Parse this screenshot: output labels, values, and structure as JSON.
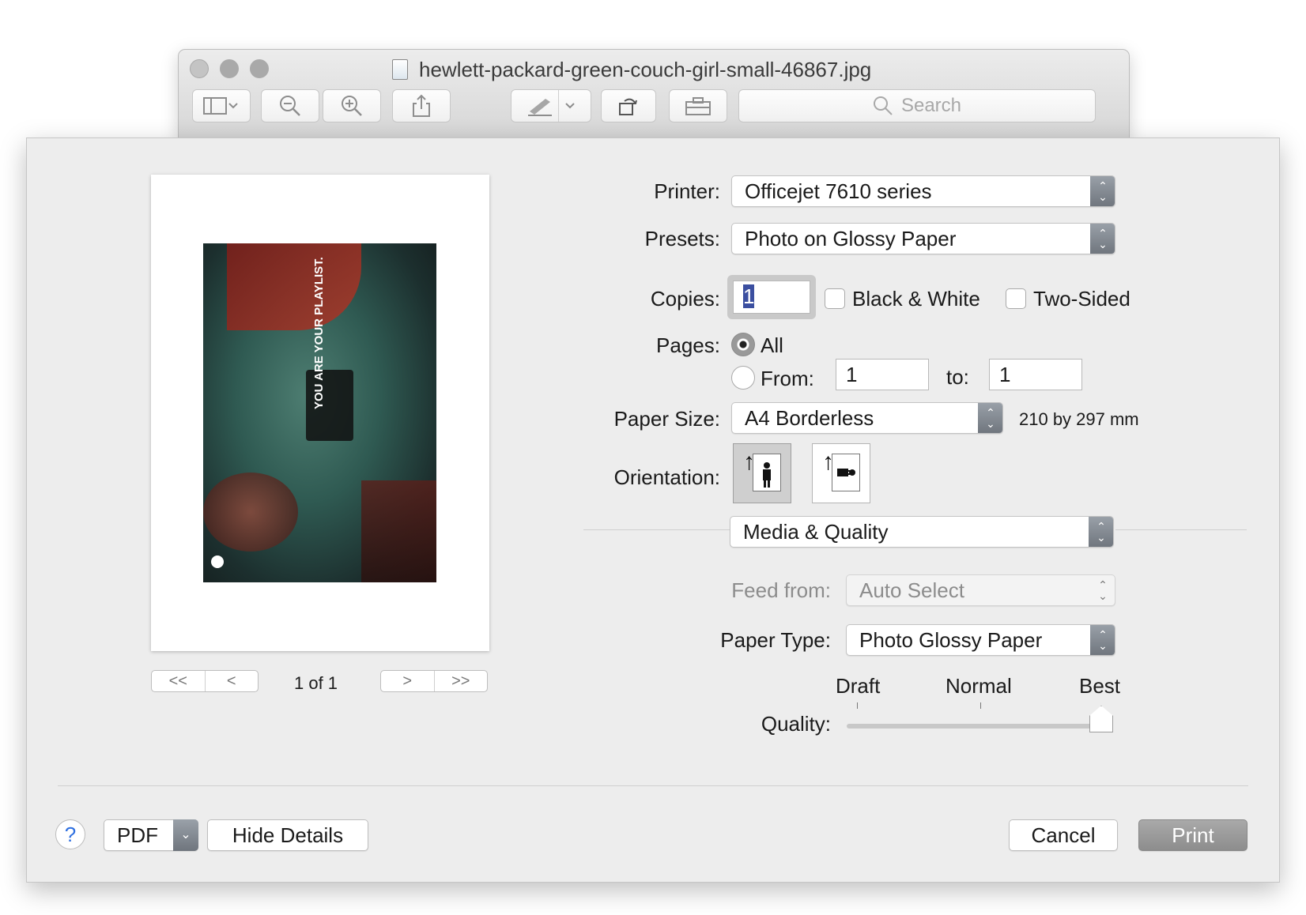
{
  "window": {
    "title": "hewlett-packard-green-couch-girl-small-46867.jpg",
    "search_placeholder": "Search"
  },
  "icons": {
    "sidebar": "sidebar-icon",
    "zoom_out": "zoom-out-icon",
    "zoom_in": "zoom-in-icon",
    "share": "share-icon",
    "markup": "pen-icon",
    "rotate": "rotate-icon",
    "toolbox": "toolbox-icon",
    "search": "magnifier-icon"
  },
  "preview": {
    "page_indicator": "1 of 1",
    "photo_caption": "YOU ARE YOUR PLAYLIST."
  },
  "form": {
    "printer_label": "Printer:",
    "printer_value": "Officejet 7610 series",
    "presets_label": "Presets:",
    "presets_value": "Photo on Glossy Paper",
    "copies_label": "Copies:",
    "copies_value": "1",
    "bw_label": "Black & White",
    "two_sided_label": "Two-Sided",
    "pages_label": "Pages:",
    "pages_all_label": "All",
    "pages_from_label": "From:",
    "pages_from_value": "1",
    "pages_to_label": "to:",
    "pages_to_value": "1",
    "paper_size_label": "Paper Size:",
    "paper_size_value": "A4 Borderless",
    "paper_size_dims": "210 by 297 mm",
    "orientation_label": "Orientation:",
    "section_value": "Media & Quality",
    "feed_label": "Feed from:",
    "feed_value": "Auto Select",
    "paper_type_label": "Paper Type:",
    "paper_type_value": "Photo Glossy Paper",
    "quality_label": "Quality:",
    "quality_draft": "Draft",
    "quality_normal": "Normal",
    "quality_best": "Best",
    "quality_level": 1.0
  },
  "footer": {
    "help": "?",
    "pdf": "PDF",
    "hide_details": "Hide Details",
    "cancel": "Cancel",
    "print": "Print"
  }
}
